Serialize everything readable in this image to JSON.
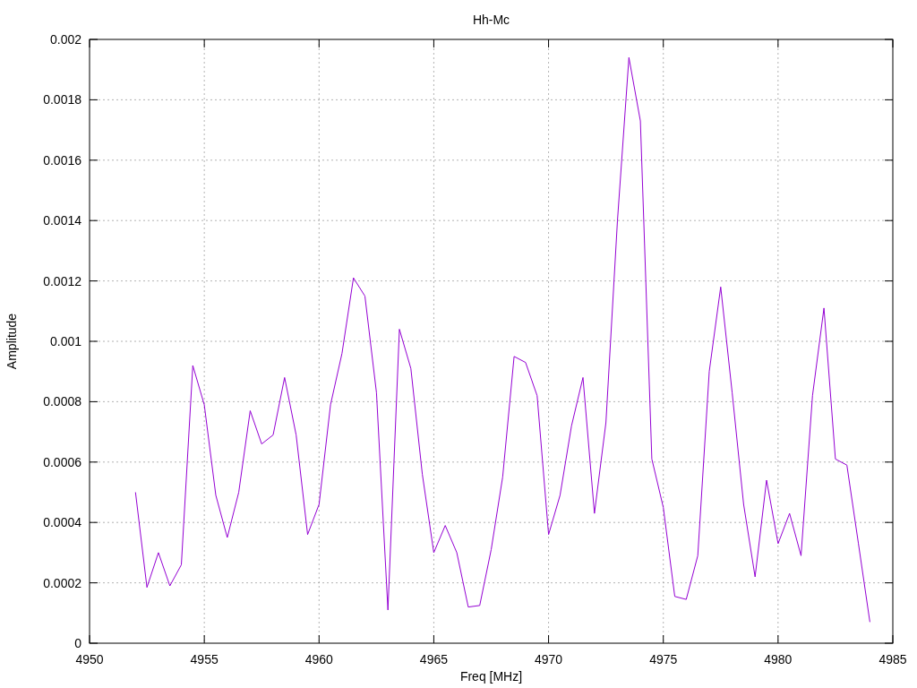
{
  "chart_data": {
    "type": "line",
    "title": "Hh-Mc",
    "xlabel": "Freq [MHz]",
    "ylabel": "Amplitude",
    "x": [
      4952,
      4952.5,
      4953,
      4953.5,
      4954,
      4954.5,
      4955,
      4955.5,
      4956,
      4956.5,
      4957,
      4957.5,
      4958,
      4958.5,
      4959,
      4959.5,
      4960,
      4960.5,
      4961,
      4961.5,
      4962,
      4962.5,
      4963,
      4963.5,
      4964,
      4964.5,
      4965,
      4965.5,
      4966,
      4966.5,
      4967,
      4967.5,
      4968,
      4968.5,
      4969,
      4969.5,
      4970,
      4970.5,
      4971,
      4971.5,
      4972,
      4972.5,
      4973,
      4973.5,
      4974,
      4974.5,
      4975,
      4975.5,
      4976,
      4976.5,
      4977,
      4977.5,
      4978,
      4978.5,
      4979,
      4979.5,
      4980,
      4980.5,
      4981,
      4981.5,
      4982,
      4982.5,
      4983,
      4983.5,
      4984
    ],
    "series": [
      {
        "color": "#9400d3",
        "values": [
          0.0005,
          0.000185,
          0.0003,
          0.00019,
          0.00026,
          0.00092,
          0.00079,
          0.00049,
          0.00035,
          0.0005,
          0.00077,
          0.00066,
          0.00069,
          0.00088,
          0.00069,
          0.00036,
          0.00046,
          0.00079,
          0.00096,
          0.00121,
          0.00115,
          0.00083,
          0.00011,
          0.00104,
          0.00091,
          0.00056,
          0.0003,
          0.00039,
          0.0003,
          0.00012,
          0.000125,
          0.00031,
          0.00055,
          0.00095,
          0.00093,
          0.00082,
          0.00036,
          0.00049,
          0.00072,
          0.00088,
          0.00043,
          0.00073,
          0.0014,
          0.00194,
          0.00173,
          0.00061,
          0.00045,
          0.000155,
          0.000145,
          0.00029,
          0.0009,
          0.00118,
          0.00083,
          0.00046,
          0.00022,
          0.00054,
          0.00033,
          0.00043,
          0.00029,
          0.00082,
          0.00111,
          0.00061,
          0.00059,
          0.00033,
          7e-05
        ]
      }
    ],
    "grid": true,
    "xlim": [
      4950,
      4985
    ],
    "ylim": [
      0,
      0.002
    ],
    "xticks": [
      4950,
      4955,
      4960,
      4965,
      4970,
      4975,
      4980,
      4985
    ],
    "yticks": [
      {
        "value": 0,
        "label": "0"
      },
      {
        "value": 0.0002,
        "label": "0.0002"
      },
      {
        "value": 0.0004,
        "label": "0.0004"
      },
      {
        "value": 0.0006,
        "label": "0.0006"
      },
      {
        "value": 0.0008,
        "label": "0.0008"
      },
      {
        "value": 0.001,
        "label": "0.001"
      },
      {
        "value": 0.0012,
        "label": "0.0012"
      },
      {
        "value": 0.0014,
        "label": "0.0014"
      },
      {
        "value": 0.0016,
        "label": "0.0016"
      },
      {
        "value": 0.0018,
        "label": "0.0018"
      },
      {
        "value": 0.002,
        "label": "0.002"
      }
    ]
  }
}
